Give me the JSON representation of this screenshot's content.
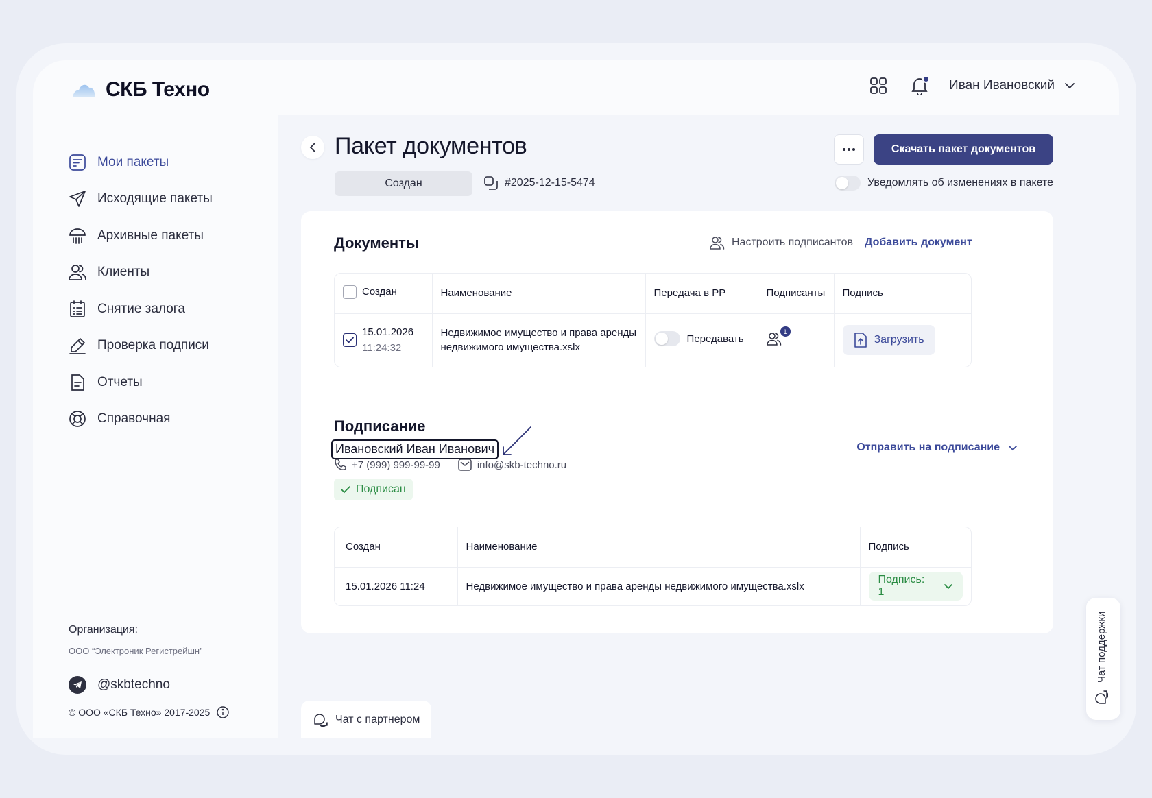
{
  "brand": {
    "name": "СКБ Техно"
  },
  "header": {
    "user_name": "Иван Ивановский"
  },
  "sidebar": {
    "items": [
      {
        "label": "Мои пакеты",
        "icon": "package-icon"
      },
      {
        "label": "Исходящие пакеты",
        "icon": "send-icon"
      },
      {
        "label": "Архивные пакеты",
        "icon": "archive-icon"
      },
      {
        "label": "Клиенты",
        "icon": "users-icon"
      },
      {
        "label": "Снятие залога",
        "icon": "list-icon"
      },
      {
        "label": "Проверка подписи",
        "icon": "signature-icon"
      },
      {
        "label": "Отчеты",
        "icon": "report-icon"
      },
      {
        "label": "Справочная",
        "icon": "help-icon"
      }
    ],
    "org_label": "Организация:",
    "org_name": "ООО “Электроник Регистрейшн”",
    "telegram": "@skbtechno",
    "copyright": "© ООО «СКБ Техно» 2017-2025"
  },
  "page": {
    "title": "Пакет документов",
    "status": "Создан",
    "package_id": "#2025-12-15-5474",
    "download_button": "Скачать пакет документов",
    "notify_label": "Уведомлять об изменениях в пакете"
  },
  "documents": {
    "title": "Документы",
    "configure_signers": "Настроить подписантов",
    "add_document": "Добавить документ",
    "columns": [
      "Создан",
      "Наименование",
      "Передача в РР",
      "Подписанты",
      "Подпись"
    ],
    "rows": [
      {
        "date": "15.01.2026",
        "time": "11:24:32",
        "name_line1": "Недвижимое имущество и права аренды",
        "name_line2": "недвижимого имущества.xslx",
        "transfer_label": "Передавать",
        "signers_count": "1",
        "upload_label": "Загрузить"
      }
    ]
  },
  "signing": {
    "title": "Подписание",
    "signer_name": "Ивановский Иван Иванович",
    "phone": "+7 (999) 999-99-99",
    "email": "info@skb-techno.ru",
    "status": "Подписан",
    "send_label": "Отправить на подписание",
    "columns": [
      "Создан",
      "Наименование",
      "Подпись"
    ],
    "rows": [
      {
        "created": "15.01.2026 11:24",
        "name": "Недвижимое имущество и права аренды недвижимого имущества.xslx",
        "signature": "Подпись: 1"
      }
    ]
  },
  "chat_partner": "Чат с партнером",
  "support_chat": "Чат поддержки",
  "colors": {
    "accent": "#3b4384",
    "link": "#3c4a9a",
    "success": "#2a8c43",
    "success_bg": "#ecf7ee"
  }
}
